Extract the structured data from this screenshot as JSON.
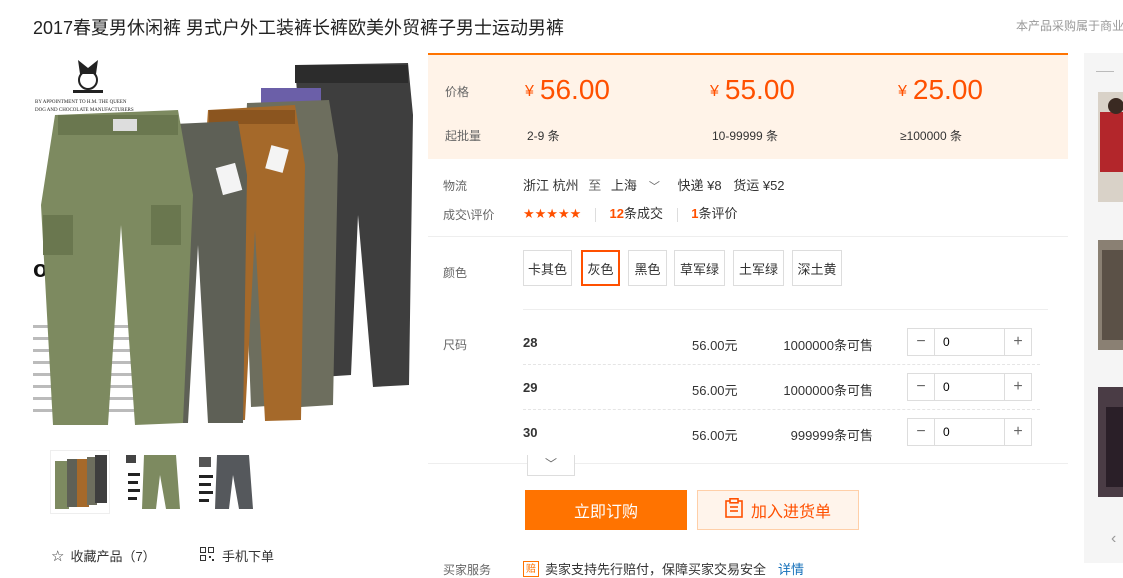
{
  "title": "2017春夏男休闲裤 男式户外工装裤长裤欧美外贸裤子男士运动男裤",
  "notice": "本产品采购属于商业",
  "gallery": {
    "thumbnail_count": 3,
    "favorite_label": "收藏产品（7）",
    "mobile_order_label": "手机下单",
    "image_text": {
      "crest_line1": "BY APPOINTMENT TO H.M. THE QUEEN",
      "crest_line2": "DOG AND CHOCOLATE MANUFACTURERS",
      "headline_fragment": "ov  Can"
    }
  },
  "price_box": {
    "price_label": "价格",
    "moq_label": "起批量",
    "currency": "¥",
    "tiers": [
      {
        "price": "56.00",
        "range": "2-9 条"
      },
      {
        "price": "55.00",
        "range": "10-99999 条"
      },
      {
        "price": "25.00",
        "range": "≥100000 条"
      }
    ]
  },
  "logistics": {
    "label": "物流",
    "from": "浙江 杭州",
    "to_word": "至",
    "to": "上海",
    "express": "快递 ¥8",
    "freight": "货运 ¥52"
  },
  "deals": {
    "label": "成交\\评价",
    "stars": "★★★★★",
    "deal_count": "12",
    "deal_suffix": "条成交",
    "review_count": "1",
    "review_suffix": "条评价"
  },
  "colors": {
    "label": "颜色",
    "options": [
      "卡其色",
      "灰色",
      "黑色",
      "草军绿",
      "土军绿",
      "深土黄"
    ],
    "selected": "灰色"
  },
  "sizes": {
    "label": "尺码",
    "rows": [
      {
        "name": "28",
        "price": "56.00元",
        "stock": "1000000条可售",
        "qty": "0"
      },
      {
        "name": "29",
        "price": "56.00元",
        "stock": "1000000条可售",
        "qty": "0"
      },
      {
        "name": "30",
        "price": "56.00元",
        "stock": "999999条可售",
        "qty": "0"
      }
    ]
  },
  "actions": {
    "order_label": "立即订购",
    "cart_label": "加入进货单"
  },
  "service": {
    "label": "买家服务",
    "badge": "赔",
    "text": "卖家支持先行赔付，保障买家交易安全",
    "detail": "详情"
  },
  "theme": {
    "accent": "#ff5000",
    "button_orange": "#ff7300",
    "price_bg": "#fff3e8",
    "link": "#1570ba"
  }
}
